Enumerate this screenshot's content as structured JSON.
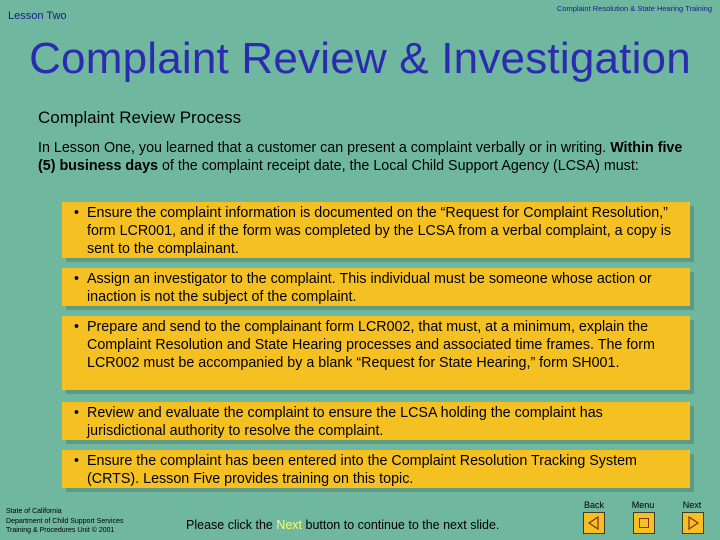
{
  "header": {
    "lesson": "Lesson Two",
    "course": "Complaint Resolution & State Hearing Training"
  },
  "title": "Complaint Review & Investigation",
  "section_heading": "Complaint Review Process",
  "intro": {
    "part1": "In Lesson One, you learned that a customer can present a complaint verbally or in writing. ",
    "bold": "Within five (5) business days",
    "part2": " of the complaint receipt date, the Local Child Support Agency (LCSA) must:"
  },
  "bullets": [
    "Ensure the complaint information is documented on the “Request for Complaint Resolution,” form LCR001, and if the form was completed by the LCSA from a verbal complaint, a copy is sent to the complainant.",
    "Assign an investigator to the complaint.  This individual must be someone whose action or inaction is not the subject of the complaint.",
    "Prepare and send to the complainant form LCR002, that must, at a minimum, explain the Complaint Resolution and State Hearing processes and associated time frames.  The form LCR002 must be accompanied by a blank “Request for State Hearing,” form SH001.",
    "Review and evaluate the complaint to ensure the LCSA holding the complaint has jurisdictional authority to resolve the complaint.",
    "Ensure the complaint has been entered into the Complaint Resolution Tracking System (CRTS).  Lesson Five provides training on this topic."
  ],
  "bullet_char": "•",
  "footer": {
    "org_line1": "State of California",
    "org_line2": "Department of Child Support Services",
    "org_line3": "Training & Procedures Unit  © 2001",
    "msg_pre": "Please click the ",
    "msg_hl": "Next",
    "msg_post": " button to continue to the next slide."
  },
  "nav": {
    "back": "Back",
    "menu": "Menu",
    "next": "Next"
  },
  "colors": {
    "background": "#6fb79e",
    "box": "#f5c021",
    "title": "#2b2bb0",
    "highlight": "#ffff66"
  }
}
